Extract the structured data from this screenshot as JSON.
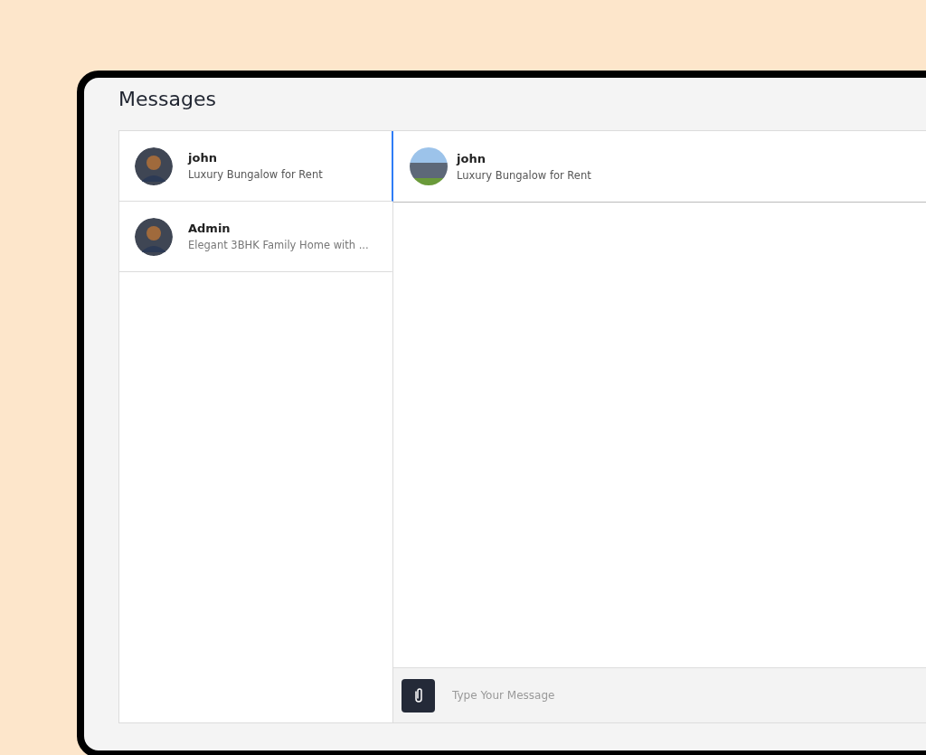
{
  "title": "Messages",
  "conversations": [
    {
      "name": "john",
      "subject": "Luxury Bungalow for Rent",
      "selected": true
    },
    {
      "name": "Admin",
      "subject": "Elegant 3BHK Family Home with ...",
      "selected": false
    }
  ],
  "chat": {
    "name": "john",
    "subject": "Luxury Bungalow for Rent"
  },
  "composer": {
    "placeholder": "Type Your Message"
  }
}
